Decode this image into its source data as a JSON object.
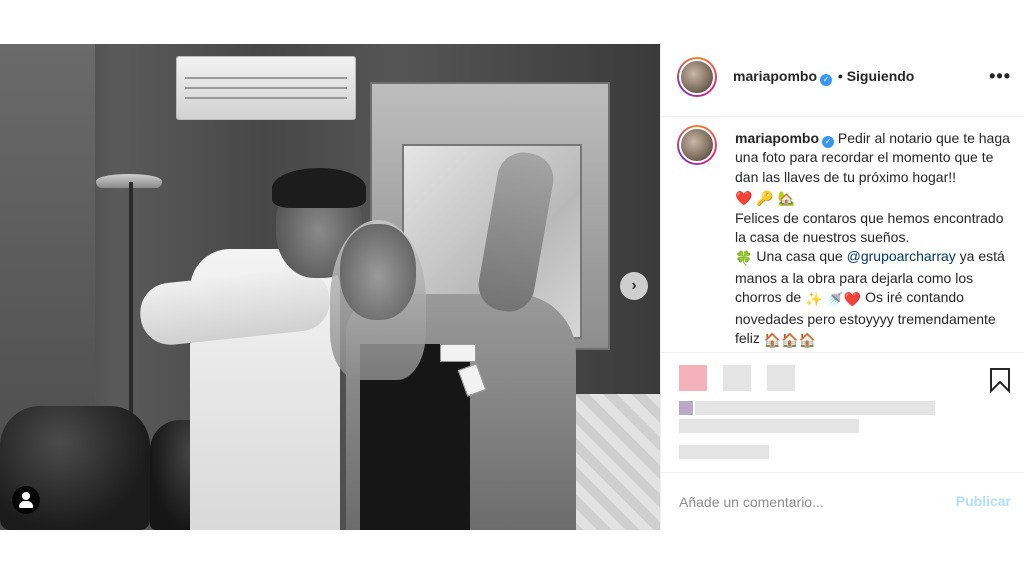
{
  "post": {
    "username": "mariapombo",
    "follow_status": "• Siguiendo",
    "more_label": "•••",
    "caption": {
      "part1": "Pedir al notario que te haga una foto para recordar el momento que te dan las llaves de tu próximo hogar!!",
      "part1_emoji": "❤️ 🔑 🏡",
      "part2": "Felices de contaros que hemos encontrado la casa de nuestros sueños.",
      "part3_emoji": "🍀",
      "part3a": "Una casa que",
      "mention": "@grupoarcharray",
      "part3b": "ya está manos a la obra para dejarla como los chorros de",
      "part3_emoji2": "✨ 🚿❤️",
      "part4": "Os iré contando novedades pero estoyyyy tremendamente feliz",
      "part4_emoji": "🏠🏠🏠"
    },
    "carousel_next": "›",
    "comment": {
      "placeholder": "Añade un comentario...",
      "publish_label": "Publicar"
    }
  },
  "colors": {
    "accent_link": "#00376b",
    "verified": "#3897f0",
    "publish_disabled": "#b2dffc",
    "heart": "#e0245e"
  },
  "icons": [
    "verified-badge-icon",
    "more-options-icon",
    "carousel-next-icon",
    "tagged-user-icon",
    "bookmark-icon"
  ]
}
